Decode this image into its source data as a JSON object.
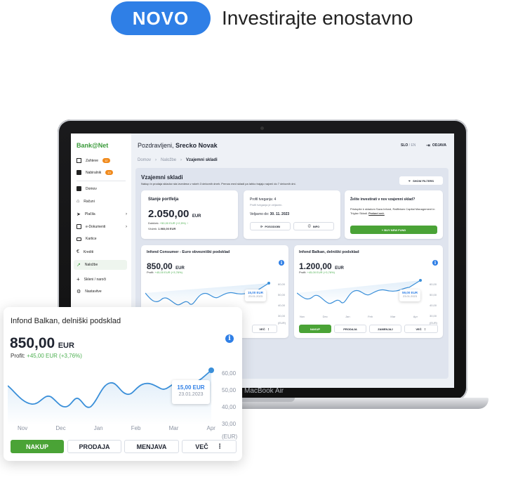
{
  "headline": {
    "badge": "NOVO",
    "tagline": "Investirajte enostavno"
  },
  "laptop": {
    "model_label": "MacBook Air"
  },
  "app": {
    "logo": "Bank@Net",
    "sidebar": {
      "items": [
        {
          "label": "Zahteve",
          "badge": "12"
        },
        {
          "label": "Nabiralnik",
          "badge": "13"
        },
        {
          "label": "Domov"
        },
        {
          "label": "Računi"
        },
        {
          "label": "Plačila"
        },
        {
          "label": "e-Dokumenti"
        },
        {
          "label": "Kartice"
        },
        {
          "label": "Krediti"
        },
        {
          "label": "Naložbe"
        },
        {
          "label": "Skleni / naroči"
        },
        {
          "label": "Nastavitve"
        }
      ]
    },
    "header": {
      "greeting": "Pozdravljeni,",
      "user": "Srecko Novak",
      "lang_active": "SLO",
      "lang_sep": " / ",
      "lang_other": "EN",
      "logout": "ODJAVA"
    },
    "breadcrumb": {
      "home": "Domov",
      "level2": "Naložbe",
      "current": "Vzajemni skladi"
    },
    "funds": {
      "title": "Vzajemni skladi",
      "subtitle": "Nakup in prodaja skladov sta izvedena v rokeh 3 delovnih dneh. Prenos med skladi pa lahko trajajo največ do 7 delovnih dni.",
      "filters_button": "SHOW FILTERS"
    },
    "portfolio_card": {
      "title": "Stanje portfelja",
      "amount": "2.050,00",
      "currency": "EUR",
      "profit_label": "Dobiček:",
      "profit_value": "+50,00 EUR (+2,5%)",
      "deposit_label": "Vložek:",
      "deposit_value": "1.960,00 EUR"
    },
    "risk_card": {
      "title": "Profil tveganja: 4",
      "subtitle": "Profil tveganja je veljaven.",
      "valid_label": "Veljavno do:",
      "valid_date": "30. 11. 2023",
      "refresh_button": "POSODOBI",
      "info_button": "INFO"
    },
    "new_fund_card": {
      "title": "Želite investirati v nov vzajemni sklad?",
      "text": "Pristopite k skladom Sava Infond, Raiffeisen Capital Management in Triglav Skladi.",
      "link": "Preberi več.",
      "button": "+ BUY NEW FUND"
    },
    "fund_cards": [
      {
        "title": "Infond Consumer - Euro obvezniški podsklad",
        "amount": "850,00",
        "currency": "EUR",
        "profit_label": "Profit:",
        "profit_value": "+45,00 EUR (+3,76%)",
        "tooltip_value": "15,00 EUR",
        "tooltip_date": "23.01.2023",
        "y_ticks": [
          "60,00",
          "50,00",
          "40,00",
          "30,00",
          "(EUR)"
        ],
        "more": "VEČ"
      },
      {
        "title": "Infond Balkan, delniški podsklad",
        "amount": "1.200,00",
        "currency": "EUR",
        "profit_label": "Profit:",
        "profit_value": "+45,00 EUR (+3,76%)",
        "tooltip_value": "59,00 EUR",
        "tooltip_date": "23.01.2023",
        "x_ticks": [
          "Nov",
          "Dec",
          "Jan",
          "Feb",
          "Mar",
          "Apr"
        ],
        "y_ticks": [
          "60,00",
          "50,00",
          "40,00",
          "30,00",
          "(EUR)"
        ],
        "buttons": {
          "buy": "NAKUP",
          "sell": "PRODAJA",
          "swap": "ZAMENJAJ",
          "more": "VEČ"
        }
      }
    ]
  },
  "floating_card": {
    "title": "Infond Balkan, delniški podsklad",
    "amount": "850,00",
    "currency": "EUR",
    "profit_label": "Profit:",
    "profit_value": "+45,00 EUR (+3,76%)",
    "tooltip_value": "15,00 EUR",
    "tooltip_date": "23.01.2023",
    "x_ticks": [
      "Nov",
      "Dec",
      "Jan",
      "Feb",
      "Mar",
      "Apr"
    ],
    "y_ticks": [
      "60,00",
      "50,00",
      "40,00",
      "30,00",
      "(EUR)"
    ],
    "buttons": {
      "buy": "NAKUP",
      "sell": "PRODAJA",
      "swap": "MENJAVA",
      "more": "VEČ"
    }
  },
  "colors": {
    "accent": "#2f7fe6",
    "buy": "#4aa336",
    "profit": "#4caf50",
    "line": "#3a8fd9"
  }
}
